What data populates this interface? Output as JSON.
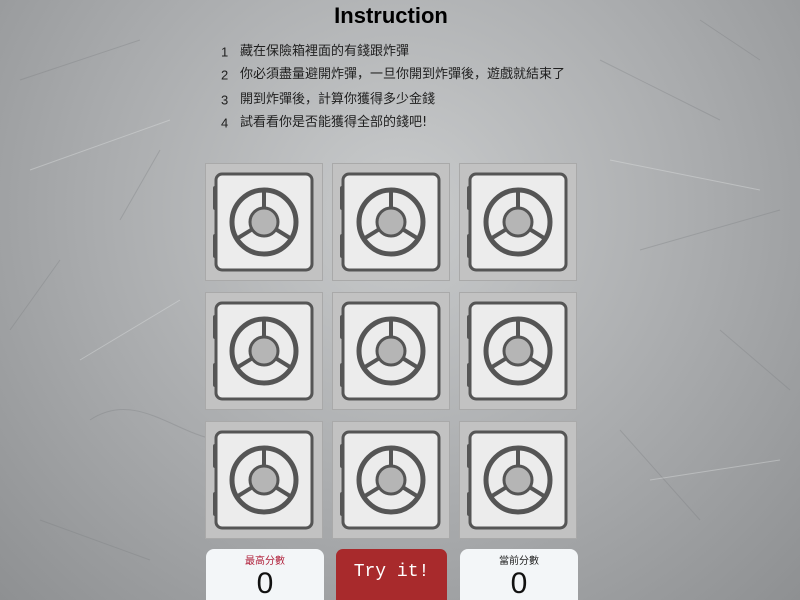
{
  "title": "Instruction",
  "instructions": [
    {
      "num": "1",
      "text": "藏在保險箱裡面的有錢跟炸彈"
    },
    {
      "num": "2",
      "text": "你必須盡量避開炸彈，一旦你開到炸彈後，遊戲就結束了"
    },
    {
      "num": "3",
      "text": "開到炸彈後，計算你獲得多少金錢"
    },
    {
      "num": "4",
      "text": "試看看你是否能獲得全部的錢吧!"
    }
  ],
  "safes": [
    {
      "state": "closed"
    },
    {
      "state": "closed"
    },
    {
      "state": "closed"
    },
    {
      "state": "closed"
    },
    {
      "state": "closed"
    },
    {
      "state": "closed"
    },
    {
      "state": "closed"
    },
    {
      "state": "closed"
    },
    {
      "state": "closed"
    }
  ],
  "high_score": {
    "label": "最高分數",
    "value": "0",
    "label_color": "#b0203a"
  },
  "current_score": {
    "label": "當前分數",
    "value": "0",
    "label_color": "#222222"
  },
  "try_button": {
    "label": "Try it!",
    "color": "#a82a2c"
  },
  "icons": {
    "safe": "safe-dial-icon"
  }
}
